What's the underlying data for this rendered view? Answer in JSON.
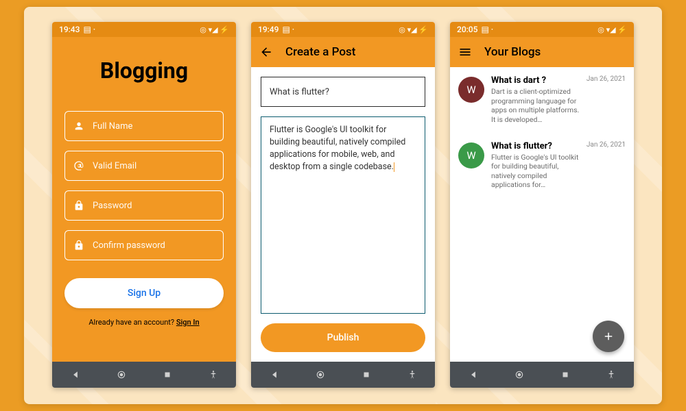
{
  "phones": [
    {
      "status": {
        "time": "19:43",
        "icons": "◎ ▾◢ ⚡"
      },
      "title": "Blogging",
      "fields": {
        "name": "Full Name",
        "email": "Valid Email",
        "password": "Password",
        "confirm": "Confirm password"
      },
      "signup_label": "Sign Up",
      "prompt": "Already have an account? ",
      "signin": "Sign In"
    },
    {
      "status": {
        "time": "19:49",
        "icons": "◎ ▾◢ ⚡"
      },
      "appbar_title": "Create a Post",
      "title_value": "What is flutter?",
      "body_value": "Flutter is Google's UI toolkit for building beautiful, natively compiled applications for mobile, web, and desktop from a single codebase.",
      "publish_label": "Publish"
    },
    {
      "status": {
        "time": "20:05",
        "icons": "◎ ▾◢ ⚡"
      },
      "appbar_title": "Your Blogs",
      "items": [
        {
          "avatar": "W",
          "color": "maroon",
          "title": "What is dart ?",
          "desc": "Dart is a client-optimized programming language for apps on multiple platforms. It is developed…",
          "date": "Jan 26, 2021"
        },
        {
          "avatar": "W",
          "color": "green",
          "title": "What is flutter?",
          "desc": "Flutter is Google's UI toolkit for building beautiful, natively compiled applications for…",
          "date": "Jan 26, 2021"
        }
      ],
      "fab": "+"
    }
  ]
}
